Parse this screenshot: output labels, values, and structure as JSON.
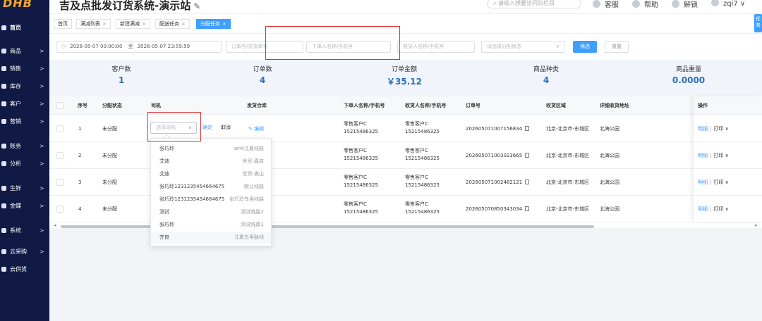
{
  "app": {
    "logo": "DHB",
    "title": "吉及点批发订货系统-演示站",
    "edit_icon": "✎",
    "top_search_placeholder": "请输入想要访问的栏目",
    "top_links": [
      "客服",
      "帮助",
      "解锁",
      "zqi7 ∨"
    ]
  },
  "sidebar": {
    "items": [
      {
        "label": "首页",
        "arrow": ""
      },
      {
        "label": "商品",
        "arrow": ">"
      },
      {
        "label": "销售",
        "arrow": ">"
      },
      {
        "label": "库存",
        "arrow": ">"
      },
      {
        "label": "客户",
        "arrow": ">"
      },
      {
        "label": "营销",
        "arrow": ">"
      },
      {
        "label": "账务",
        "arrow": ">"
      },
      {
        "label": "分析",
        "arrow": ">"
      },
      {
        "label": "生鲜",
        "arrow": ">"
      },
      {
        "label": "金蝶",
        "arrow": ">"
      },
      {
        "label": "系统",
        "arrow": ">"
      },
      {
        "label": "云采购",
        "arrow": ">"
      },
      {
        "label": "云供货",
        "arrow": ""
      }
    ]
  },
  "tabs": {
    "items": [
      {
        "label": "首页",
        "close": ""
      },
      {
        "label": "满减列表",
        "close": "×"
      },
      {
        "label": "新建满减",
        "close": "×"
      },
      {
        "label": "配送任务",
        "close": "×"
      },
      {
        "label": "分配任务",
        "close": "×"
      }
    ],
    "side_task": "任务"
  },
  "filters": {
    "date_start": "2026-05-07 00:00:00",
    "date_sep": "至",
    "date_end": "2026-05-07 23:59:59",
    "order_no_placeholder": "订单号/货货单号",
    "buyer_placeholder": "下单人名称/手机号",
    "receiver_placeholder": "收货人名称/手机号",
    "status_placeholder": "请选择分配状态",
    "filter_button": "筛选",
    "reset_button": "重置"
  },
  "stats": [
    {
      "label": "客户数",
      "value": "1"
    },
    {
      "label": "订单数",
      "value": "4"
    },
    {
      "label": "订单金额",
      "value": "￥35.12"
    },
    {
      "label": "商品种类",
      "value": "4"
    },
    {
      "label": "商品重量",
      "value": "0.0000"
    }
  ],
  "table": {
    "headers": {
      "seq": "序号",
      "status": "分配状态",
      "driver": "司机",
      "warehouse": "发货仓库",
      "buyer": "下单人名称/手机号",
      "receiver": "收货人名称/手机号",
      "order_no": "订单号",
      "area": "收货区域",
      "address": "详细收货地址",
      "ops": "操作"
    },
    "rows": [
      {
        "seq": "1",
        "status": "未分配",
        "buyer": "零售客户C",
        "buyer_phone": "15215486325",
        "receiver": "零售客户C",
        "receiver_phone": "15215486325",
        "order_no": "202605071007156834",
        "area": "北京-北京市-东城区",
        "address": "北海公园",
        "detail": "明细",
        "print": "打印 ∨"
      },
      {
        "seq": "2",
        "status": "未分配",
        "buyer": "零售客户C",
        "buyer_phone": "15215486325",
        "receiver": "零售客户C",
        "receiver_phone": "15215486325",
        "order_no": "202605071003023665",
        "area": "北京-北京市-东城区",
        "address": "北海公园",
        "detail": "明细",
        "print": "打印 ∨"
      },
      {
        "seq": "3",
        "status": "未分配",
        "buyer": "零售客户C",
        "buyer_phone": "15215486325",
        "receiver": "零售客户C",
        "receiver_phone": "15215486325",
        "order_no": "202605071002482121",
        "area": "北京-北京市-东城区",
        "address": "北海公园",
        "detail": "明细",
        "print": "打印 ∨"
      },
      {
        "seq": "4",
        "status": "未分配",
        "buyer": "零售客户C",
        "buyer_phone": "15215486325",
        "receiver": "零售客户C",
        "receiver_phone": "15215486325",
        "order_no": "202605070850343034",
        "area": "北京-北京市-东城区",
        "address": "北海公园",
        "detail": "明细",
        "print": "打印 ∨"
      }
    ],
    "row1_editor": {
      "select_placeholder": "选择司机",
      "confirm": "确定",
      "cancel": "取消",
      "edit": "编辑"
    }
  },
  "driver_dropdown": {
    "options": [
      {
        "name": "张巧玲",
        "route": "wnk江夏线路"
      },
      {
        "name": "艾迪",
        "route": "世贸-嘉店"
      },
      {
        "name": "艾迪",
        "route": "世贸-嵩山"
      },
      {
        "name": "张巧玲1231235454664675",
        "route": "默认线路"
      },
      {
        "name": "张巧玲1231235454664675",
        "route": "张巧玲专用线路"
      },
      {
        "name": "测试",
        "route": "测试线路2"
      },
      {
        "name": "张巧玲",
        "route": "测试线路1"
      },
      {
        "name": "齐良",
        "route": "江夏五甲路线"
      }
    ]
  }
}
